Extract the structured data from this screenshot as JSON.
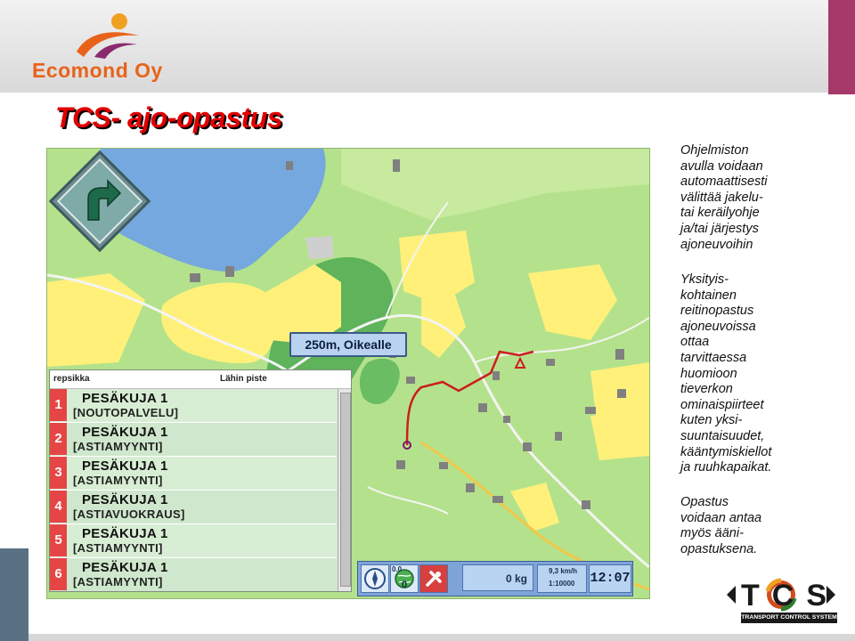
{
  "company": {
    "name": "Ecomond Oy"
  },
  "title": "TCS- ajo-opastus",
  "colors": {
    "accent_orange": "#e8631a",
    "title_red": "#e10000",
    "corner": "#a6396a",
    "map_green": "#b4e28c",
    "route_red": "#cc1e1e"
  },
  "map": {
    "turn_sign_icon": "turn-right-arrow-icon",
    "instruction": "250m, Oikealle",
    "route_panel": {
      "header_left": "repsikka",
      "header_right": "Lähin piste",
      "rows": [
        {
          "num": "1",
          "name": "PESÄKUJA 1",
          "type": "[NOUTOPALVELU]"
        },
        {
          "num": "2",
          "name": "PESÄKUJA 1",
          "type": "[ASTIAMYYNTI]"
        },
        {
          "num": "3",
          "name": "PESÄKUJA 1",
          "type": "[ASTIAMYYNTI]"
        },
        {
          "num": "4",
          "name": "PESÄKUJA 1",
          "type": "[ASTIAVUOKRAUS]"
        },
        {
          "num": "5",
          "name": "PESÄKUJA 1",
          "type": "[ASTIAMYYNTI]"
        },
        {
          "num": "6",
          "name": "PESÄKUJA 1",
          "type": "[ASTIAMYYNTI]"
        }
      ]
    },
    "statusbar": {
      "counter_top": "0.0",
      "counter_bottom": "0",
      "weight": "0 kg",
      "speed": "9,3 km/h",
      "scale": "1:10000",
      "clock": "12:07",
      "icons": [
        "compass-icon",
        "globe-icon",
        "wrench-tools-icon"
      ]
    }
  },
  "paragraphs": [
    "Ohjelmiston\navulla voidaan\nautomaattisesti\nvälittää jakelu-\ntai keräilyohje\nja/tai järjestys\najoneuvoihin",
    "Yksityis-\nkohtainen\nreitinopastus\najoneuvoissa\nottaa\ntarvittaessa\nhuomioon\ntieverkon\nominaispiirteet\nkuten yksi-\nsuuntaisuudet,\nkääntymiskiellot\nja ruuhkapaikat.",
    "Opastus\nvoidaan antaa\nmyös ääni-\nopastuksena."
  ],
  "tcs_logo": {
    "letters": "TCS",
    "tagline": "TRANSPORT CONTROL SYSTEM"
  }
}
